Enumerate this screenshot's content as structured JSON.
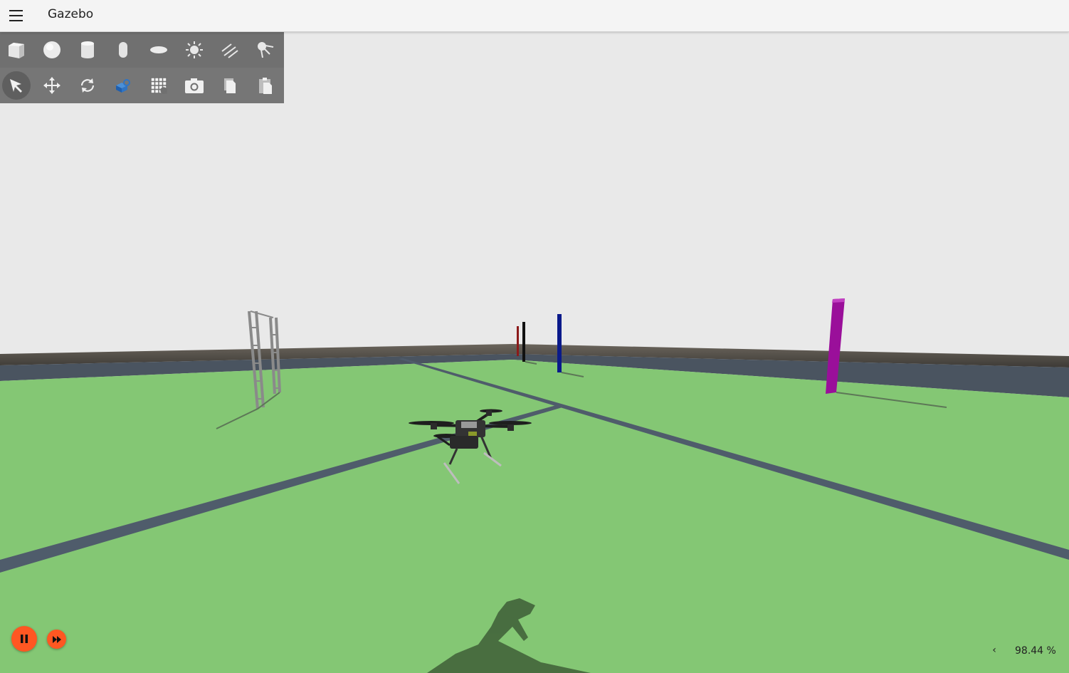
{
  "app": {
    "title": "Gazebo"
  },
  "toolbar": {
    "shapes": [
      {
        "name": "box-icon",
        "tooltip": "Box"
      },
      {
        "name": "sphere-icon",
        "tooltip": "Sphere"
      },
      {
        "name": "cylinder-icon",
        "tooltip": "Cylinder"
      },
      {
        "name": "capsule-icon",
        "tooltip": "Capsule"
      },
      {
        "name": "ellipsoid-icon",
        "tooltip": "Ellipsoid"
      },
      {
        "name": "point-light-icon",
        "tooltip": "Point light"
      },
      {
        "name": "directional-light-icon",
        "tooltip": "Directional light"
      },
      {
        "name": "spot-light-icon",
        "tooltip": "Spot light"
      }
    ],
    "transforms": [
      {
        "name": "select-cursor-icon",
        "active": true
      },
      {
        "name": "translate-icon"
      },
      {
        "name": "rotate-icon"
      },
      {
        "name": "resource-spawner-icon"
      },
      {
        "name": "grid-snap-icon"
      },
      {
        "name": "screenshot-camera-icon"
      },
      {
        "name": "copy-icon"
      },
      {
        "name": "paste-icon"
      }
    ]
  },
  "playback": {
    "pause_icon": "pause-icon",
    "step_icon": "fast-forward-icon",
    "accent_color": "#ff5722"
  },
  "stats": {
    "expand_label": "‹",
    "real_time_factor": "98.44 %"
  },
  "scene": {
    "sky_color": "#e9e9e9",
    "ground_color": "#84c774",
    "objects": [
      "drone",
      "ladder",
      "red-pole",
      "black-pole",
      "blue-pole",
      "magenta-pillar"
    ]
  }
}
